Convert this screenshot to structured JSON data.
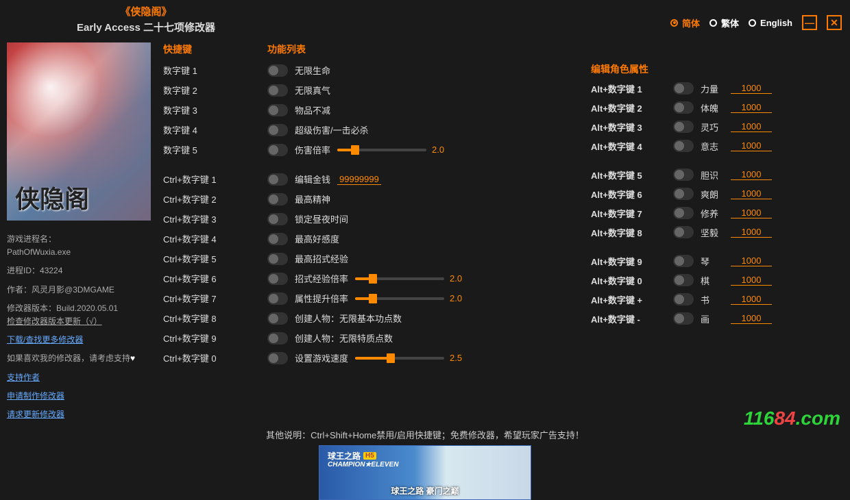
{
  "title": {
    "main": "《侠隐阁》",
    "sub": "Early Access 二十七项修改器"
  },
  "lang": {
    "simplified": "简体",
    "traditional": "繁体",
    "english": "English"
  },
  "side": {
    "cover_text": "侠隐阁",
    "proc_label": "游戏进程名：",
    "proc_val": "PathOfWuxia.exe",
    "pid_label": "进程ID：",
    "pid_val": "43224",
    "author_label": "作者：",
    "author_val": "风灵月影@3DMGAME",
    "ver_label": "修改器版本：",
    "ver_val": "Build.2020.05.01",
    "check_update": "检查修改器版本更新（√）",
    "more": "下载/查找更多修改器",
    "like": "如果喜欢我的修改器，请考虑支持",
    "support": "支持作者",
    "request_make": "申请制作修改器",
    "request_update": "请求更新修改器"
  },
  "headers": {
    "hotkey": "快捷键",
    "func": "功能列表",
    "attr": "编辑角色属性"
  },
  "hotkeys_a": [
    "数字键 1",
    "数字键 2",
    "数字键 3",
    "数字键 4",
    "数字键 5"
  ],
  "funcs_a": [
    {
      "label": "无限生命"
    },
    {
      "label": "无限真气"
    },
    {
      "label": "物品不减"
    },
    {
      "label": "超级伤害/一击必杀"
    },
    {
      "label": "伤害倍率",
      "slider": 20,
      "val": "2.0"
    }
  ],
  "hotkeys_b": [
    "Ctrl+数字键 1",
    "Ctrl+数字键 2",
    "Ctrl+数字键 3",
    "Ctrl+数字键 4",
    "Ctrl+数字键 5",
    "Ctrl+数字键 6",
    "Ctrl+数字键 7",
    "Ctrl+数字键 8",
    "Ctrl+数字键 9",
    "Ctrl+数字键 0"
  ],
  "funcs_b": [
    {
      "label": "编辑金钱",
      "edit": "99999999"
    },
    {
      "label": "最高精神"
    },
    {
      "label": "锁定昼夜时间"
    },
    {
      "label": "最高好感度"
    },
    {
      "label": "最高招式经验"
    },
    {
      "label": "招式经验倍率",
      "slider": 20,
      "val": "2.0"
    },
    {
      "label": "属性提升倍率",
      "slider": 20,
      "val": "2.0"
    },
    {
      "label": "创建人物：无限基本功点数"
    },
    {
      "label": "创建人物：无限特质点数"
    },
    {
      "label": "设置游戏速度",
      "slider": 40,
      "val": "2.5"
    }
  ],
  "attrs": [
    {
      "hot": "Alt+数字键 1",
      "name": "力量",
      "val": "1000"
    },
    {
      "hot": "Alt+数字键 2",
      "name": "体魄",
      "val": "1000"
    },
    {
      "hot": "Alt+数字键 3",
      "name": "灵巧",
      "val": "1000"
    },
    {
      "hot": "Alt+数字键 4",
      "name": "意志",
      "val": "1000"
    }
  ],
  "attrs2": [
    {
      "hot": "Alt+数字键 5",
      "name": "胆识",
      "val": "1000"
    },
    {
      "hot": "Alt+数字键 6",
      "name": "爽朗",
      "val": "1000"
    },
    {
      "hot": "Alt+数字键 7",
      "name": "修养",
      "val": "1000"
    },
    {
      "hot": "Alt+数字键 8",
      "name": "坚毅",
      "val": "1000"
    }
  ],
  "attrs3": [
    {
      "hot": "Alt+数字键 9",
      "name": "琴",
      "val": "1000"
    },
    {
      "hot": "Alt+数字键 0",
      "name": "棋",
      "val": "1000"
    },
    {
      "hot": "Alt+数字键 +",
      "name": "书",
      "val": "1000"
    },
    {
      "hot": "Alt+数字键 -",
      "name": "画",
      "val": "1000"
    }
  ],
  "bottom_note": "其他说明：Ctrl+Shift+Home禁用/启用快捷键；免费修改器，希望玩家广告支持！",
  "ad": {
    "title": "球王之路",
    "badge": "H5",
    "sub": "CHAMPION★ELEVEN",
    "caption": "球王之路 豪门之巅"
  },
  "watermark": {
    "a": "116",
    "b": "84",
    "c": ".com"
  }
}
